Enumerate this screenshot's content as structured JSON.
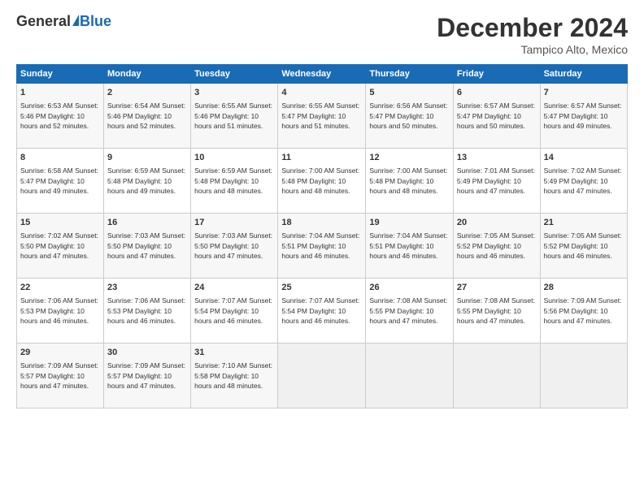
{
  "header": {
    "logo_general": "General",
    "logo_blue": "Blue",
    "month_title": "December 2024",
    "location": "Tampico Alto, Mexico"
  },
  "days_of_week": [
    "Sunday",
    "Monday",
    "Tuesday",
    "Wednesday",
    "Thursday",
    "Friday",
    "Saturday"
  ],
  "weeks": [
    [
      {
        "day": "1",
        "info": "Sunrise: 6:53 AM\nSunset: 5:46 PM\nDaylight: 10 hours\nand 52 minutes."
      },
      {
        "day": "2",
        "info": "Sunrise: 6:54 AM\nSunset: 5:46 PM\nDaylight: 10 hours\nand 52 minutes."
      },
      {
        "day": "3",
        "info": "Sunrise: 6:55 AM\nSunset: 5:46 PM\nDaylight: 10 hours\nand 51 minutes."
      },
      {
        "day": "4",
        "info": "Sunrise: 6:55 AM\nSunset: 5:47 PM\nDaylight: 10 hours\nand 51 minutes."
      },
      {
        "day": "5",
        "info": "Sunrise: 6:56 AM\nSunset: 5:47 PM\nDaylight: 10 hours\nand 50 minutes."
      },
      {
        "day": "6",
        "info": "Sunrise: 6:57 AM\nSunset: 5:47 PM\nDaylight: 10 hours\nand 50 minutes."
      },
      {
        "day": "7",
        "info": "Sunrise: 6:57 AM\nSunset: 5:47 PM\nDaylight: 10 hours\nand 49 minutes."
      }
    ],
    [
      {
        "day": "8",
        "info": "Sunrise: 6:58 AM\nSunset: 5:47 PM\nDaylight: 10 hours\nand 49 minutes."
      },
      {
        "day": "9",
        "info": "Sunrise: 6:59 AM\nSunset: 5:48 PM\nDaylight: 10 hours\nand 49 minutes."
      },
      {
        "day": "10",
        "info": "Sunrise: 6:59 AM\nSunset: 5:48 PM\nDaylight: 10 hours\nand 48 minutes."
      },
      {
        "day": "11",
        "info": "Sunrise: 7:00 AM\nSunset: 5:48 PM\nDaylight: 10 hours\nand 48 minutes."
      },
      {
        "day": "12",
        "info": "Sunrise: 7:00 AM\nSunset: 5:48 PM\nDaylight: 10 hours\nand 48 minutes."
      },
      {
        "day": "13",
        "info": "Sunrise: 7:01 AM\nSunset: 5:49 PM\nDaylight: 10 hours\nand 47 minutes."
      },
      {
        "day": "14",
        "info": "Sunrise: 7:02 AM\nSunset: 5:49 PM\nDaylight: 10 hours\nand 47 minutes."
      }
    ],
    [
      {
        "day": "15",
        "info": "Sunrise: 7:02 AM\nSunset: 5:50 PM\nDaylight: 10 hours\nand 47 minutes."
      },
      {
        "day": "16",
        "info": "Sunrise: 7:03 AM\nSunset: 5:50 PM\nDaylight: 10 hours\nand 47 minutes."
      },
      {
        "day": "17",
        "info": "Sunrise: 7:03 AM\nSunset: 5:50 PM\nDaylight: 10 hours\nand 47 minutes."
      },
      {
        "day": "18",
        "info": "Sunrise: 7:04 AM\nSunset: 5:51 PM\nDaylight: 10 hours\nand 46 minutes."
      },
      {
        "day": "19",
        "info": "Sunrise: 7:04 AM\nSunset: 5:51 PM\nDaylight: 10 hours\nand 46 minutes."
      },
      {
        "day": "20",
        "info": "Sunrise: 7:05 AM\nSunset: 5:52 PM\nDaylight: 10 hours\nand 46 minutes."
      },
      {
        "day": "21",
        "info": "Sunrise: 7:05 AM\nSunset: 5:52 PM\nDaylight: 10 hours\nand 46 minutes."
      }
    ],
    [
      {
        "day": "22",
        "info": "Sunrise: 7:06 AM\nSunset: 5:53 PM\nDaylight: 10 hours\nand 46 minutes."
      },
      {
        "day": "23",
        "info": "Sunrise: 7:06 AM\nSunset: 5:53 PM\nDaylight: 10 hours\nand 46 minutes."
      },
      {
        "day": "24",
        "info": "Sunrise: 7:07 AM\nSunset: 5:54 PM\nDaylight: 10 hours\nand 46 minutes."
      },
      {
        "day": "25",
        "info": "Sunrise: 7:07 AM\nSunset: 5:54 PM\nDaylight: 10 hours\nand 46 minutes."
      },
      {
        "day": "26",
        "info": "Sunrise: 7:08 AM\nSunset: 5:55 PM\nDaylight: 10 hours\nand 47 minutes."
      },
      {
        "day": "27",
        "info": "Sunrise: 7:08 AM\nSunset: 5:55 PM\nDaylight: 10 hours\nand 47 minutes."
      },
      {
        "day": "28",
        "info": "Sunrise: 7:09 AM\nSunset: 5:56 PM\nDaylight: 10 hours\nand 47 minutes."
      }
    ],
    [
      {
        "day": "29",
        "info": "Sunrise: 7:09 AM\nSunset: 5:57 PM\nDaylight: 10 hours\nand 47 minutes."
      },
      {
        "day": "30",
        "info": "Sunrise: 7:09 AM\nSunset: 5:57 PM\nDaylight: 10 hours\nand 47 minutes."
      },
      {
        "day": "31",
        "info": "Sunrise: 7:10 AM\nSunset: 5:58 PM\nDaylight: 10 hours\nand 48 minutes."
      },
      {
        "day": "",
        "info": ""
      },
      {
        "day": "",
        "info": ""
      },
      {
        "day": "",
        "info": ""
      },
      {
        "day": "",
        "info": ""
      }
    ]
  ]
}
